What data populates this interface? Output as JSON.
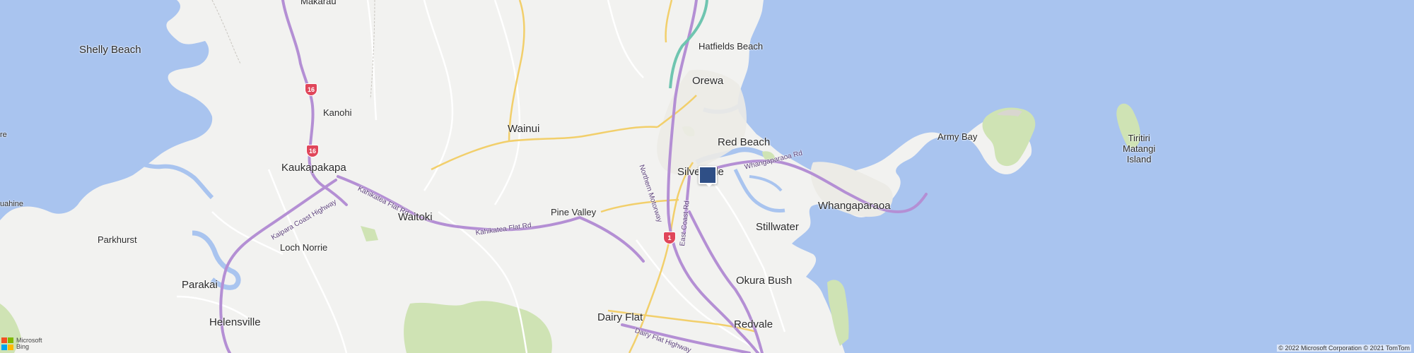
{
  "places": {
    "makarau": "Makarau",
    "shelly_beach": "Shelly Beach",
    "hatfields_beach": "Hatfields Beach",
    "orewa": "Orewa",
    "kanohi": "Kanohi",
    "wainui": "Wainui",
    "red_beach": "Red Beach",
    "army_bay": "Army Bay",
    "tiritiri": "Tiritiri",
    "matangi": "Matangi",
    "island": "Island",
    "kaukapakapa": "Kaukapakapa",
    "silverdale": "Silverdale",
    "whangaparaoa": "Whangaparaoa",
    "waitoki": "Waitoki",
    "pine_valley": "Pine Valley",
    "stillwater": "Stillwater",
    "parkhurst": "Parkhurst",
    "loch_norrie": "Loch Norrie",
    "okura_bush": "Okura Bush",
    "parakai": "Parakai",
    "helensville": "Helensville",
    "dairy_flat": "Dairy Flat",
    "redvale": "Redvale",
    "kuahine_partial": "uahine",
    "edge_partial": "re"
  },
  "roads": {
    "northern_motorway": "Northern Motorway",
    "whangaparaoa_rd": "Whangaparaoa Rd",
    "east_coast_rd": "East Coast Rd",
    "kahikatea_flat_rd_1": "Kahikatea Flat Rd",
    "kahikatea_flat_rd_2": "Kahikatea Flat Rd",
    "kaipara_coast_highway": "Kaipara Coast Highway",
    "dairy_flat_highway": "Dairy Flat Highway"
  },
  "shields": {
    "sh16_north": "16",
    "sh16_south": "16",
    "sh1": "1"
  },
  "attribution": {
    "bing_line1": "Microsoft",
    "bing_line2": "Bing",
    "copyright": "© 2022 Microsoft Corporation © 2021 TomTom"
  },
  "colors": {
    "sea": "#a9c4ef",
    "land": "#f2f2f0",
    "park": "#cfe3b4",
    "motorway": "#b48fd4",
    "arterial": "#f2cf6b",
    "marker": "#2f4f86"
  },
  "icons": {
    "marker": "location-square-marker",
    "logo": "microsoft-bing-logo"
  }
}
